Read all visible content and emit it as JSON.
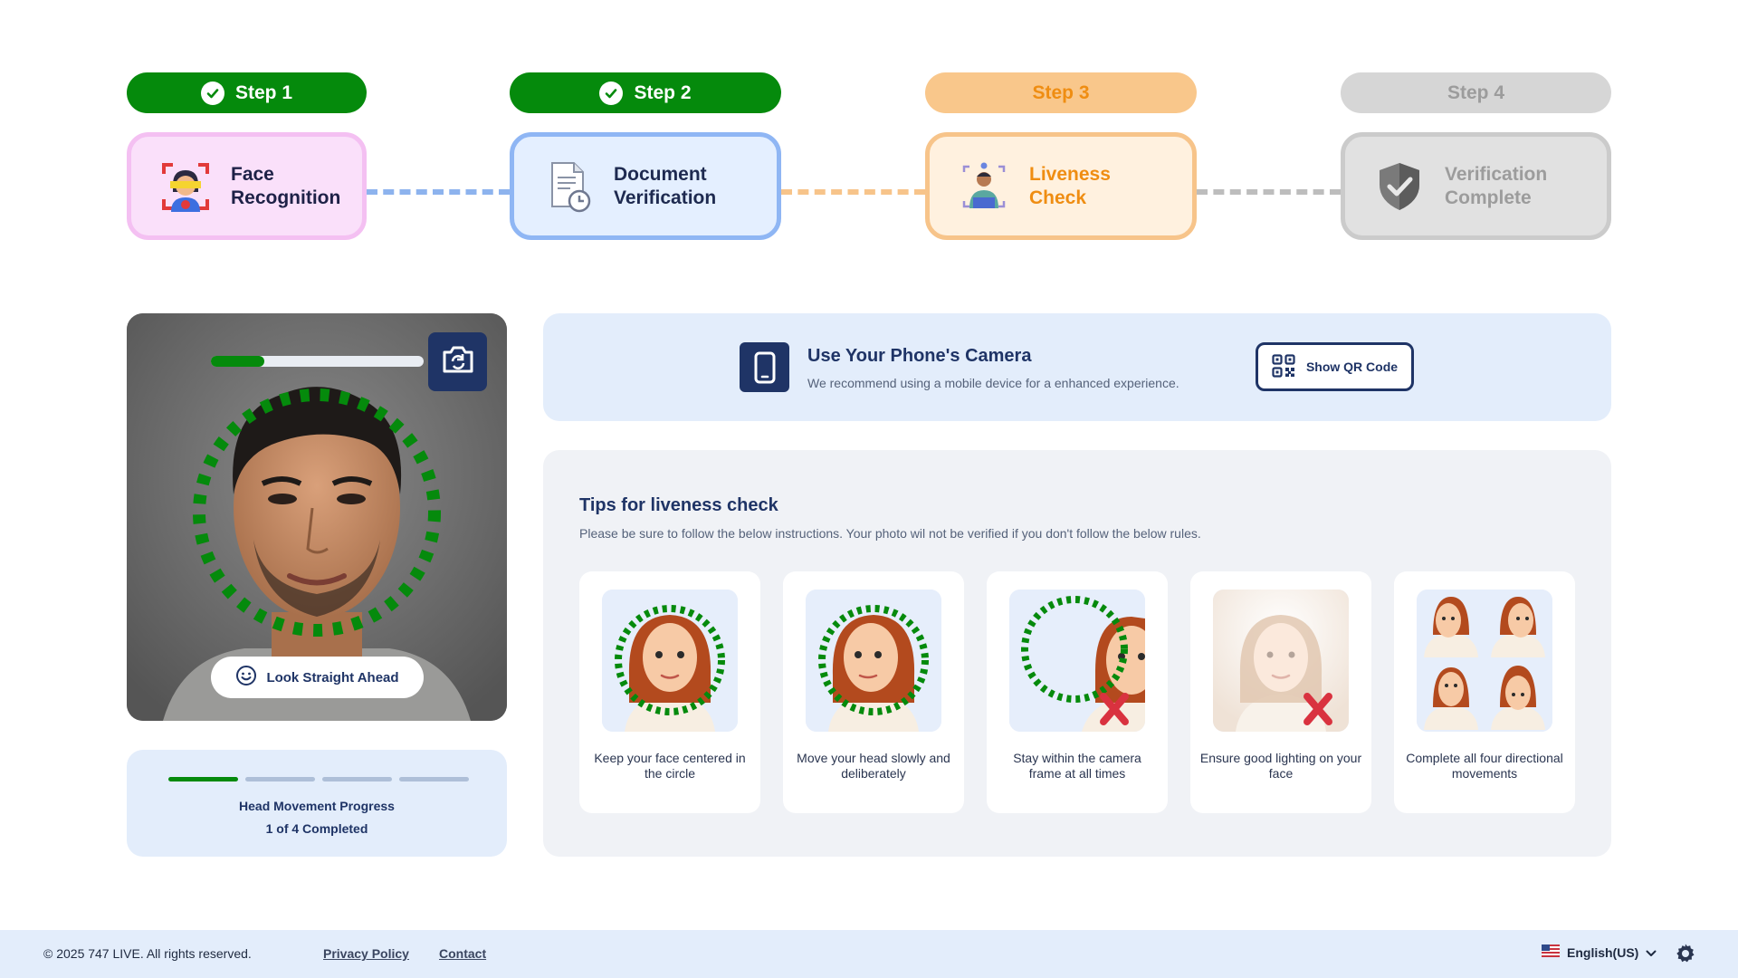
{
  "stepper": {
    "steps": [
      {
        "pill": "Step 1",
        "label": "Face\nRecognition",
        "status": "completed",
        "icon": "face-scan-icon"
      },
      {
        "pill": "Step 2",
        "label": "Document\nVerification",
        "status": "completed",
        "icon": "document-clock-icon"
      },
      {
        "pill": "Step 3",
        "label": "Liveness\nCheck",
        "status": "current",
        "icon": "person-liveness-icon"
      },
      {
        "pill": "Step 4",
        "label": "Verification\nComplete",
        "status": "pending",
        "icon": "shield-check-icon"
      }
    ]
  },
  "camera": {
    "progress": 0.25,
    "flip_icon": "camera-flip-icon",
    "instruction": "Look Straight Ahead",
    "instruction_icon": "smile-icon"
  },
  "head_progress": {
    "segments_total": 4,
    "segments_done": 1,
    "title": "Head Movement Progress",
    "count": "1 of 4 Completed"
  },
  "phone": {
    "title": "Use Your Phone's Camera",
    "subtitle": "We recommend using a mobile device for a enhanced experience.",
    "qr_label": "Show QR Code",
    "qr_icon": "qr-code-icon",
    "phone_icon": "smartphone-icon"
  },
  "tips": {
    "title": "Tips for liveness check",
    "subtitle": "Please be sure to follow the below instructions. Your photo wil not be verified if you don't follow the below rules.",
    "items": [
      {
        "text": "Keep your face centered in the circle"
      },
      {
        "text": "Move your head slowly and deliberately"
      },
      {
        "text": "Stay within the camera frame at all times"
      },
      {
        "text": "Ensure good lighting on your face"
      },
      {
        "text": "Complete all four directional movements"
      }
    ]
  },
  "footer": {
    "copyright": "© 2025 747 LIVE. All rights reserved.",
    "privacy": "Privacy Policy",
    "contact": "Contact",
    "language": "English(US)"
  },
  "colors": {
    "success": "#058a0c",
    "navy": "#1f3466",
    "warning_orange": "#ef8d12",
    "error_red": "#d9323f"
  }
}
